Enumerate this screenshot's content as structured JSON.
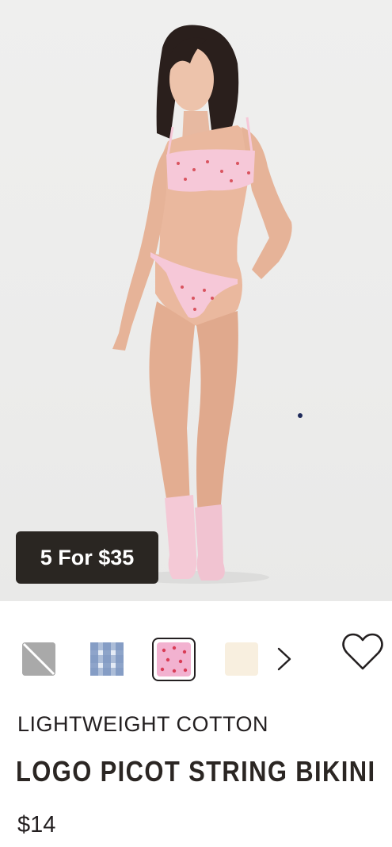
{
  "product": {
    "promo_badge": "5 For $35",
    "collection": "LIGHTWEIGHT COTTON",
    "title": "LOGO PICOT STRING BIKINI",
    "price": "$14"
  },
  "swatches": [
    {
      "name": "heather-grey",
      "color": "#a9a9a9",
      "selected": false
    },
    {
      "name": "blue-gingham",
      "color": "#8fa6cc",
      "selected": false
    },
    {
      "name": "pink-heart-print",
      "color": "#f2b2d0",
      "selected": true
    },
    {
      "name": "cream",
      "color": "#f8efdf",
      "selected": false
    }
  ],
  "icons": {
    "next": "chevron-right-icon",
    "wishlist": "heart-outline-icon"
  },
  "colors": {
    "badge_bg": "#2a2622",
    "text": "#231f20",
    "image_bg": "#ececeb"
  }
}
